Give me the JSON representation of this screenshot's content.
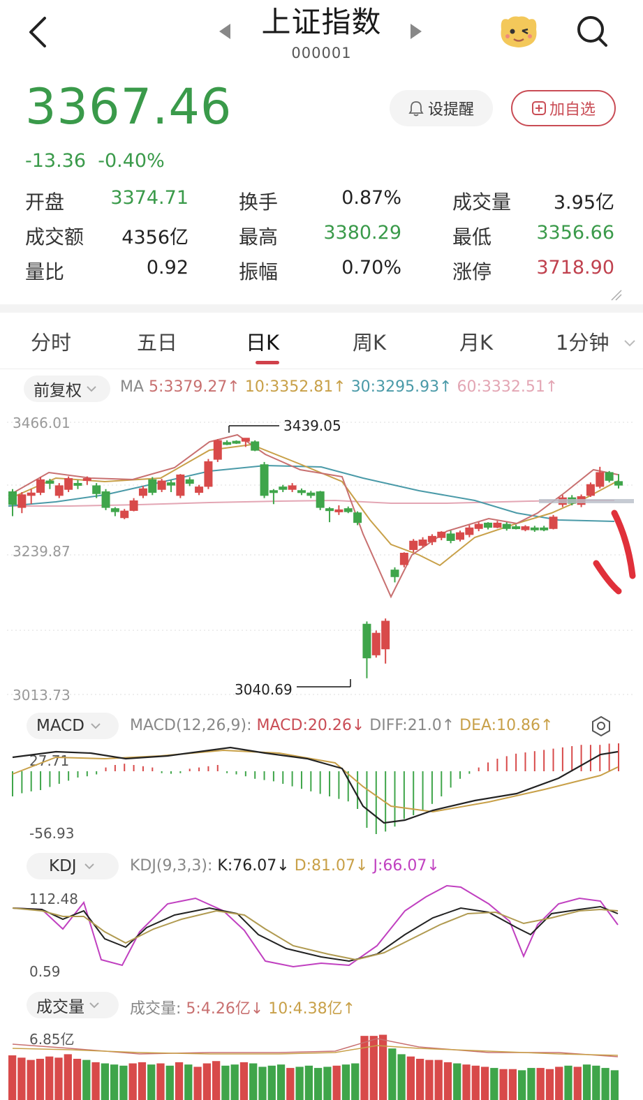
{
  "header": {
    "title": "上证指数",
    "code": "000001"
  },
  "quote": {
    "price": "3367.46",
    "change": "-13.36",
    "change_pct": "-0.40%",
    "alert_label": "设提醒",
    "add_label": "加自选"
  },
  "stats": [
    [
      {
        "label": "开盘",
        "value": "3374.71",
        "color": "green"
      },
      {
        "label": "换手",
        "value": "0.87%",
        "color": "dark"
      },
      {
        "label": "成交量",
        "value": "3.95亿",
        "color": "dark"
      }
    ],
    [
      {
        "label": "成交额",
        "value": "4356亿",
        "color": "dark"
      },
      {
        "label": "最高",
        "value": "3380.29",
        "color": "green"
      },
      {
        "label": "最低",
        "value": "3356.66",
        "color": "green"
      }
    ],
    [
      {
        "label": "量比",
        "value": "0.92",
        "color": "dark"
      },
      {
        "label": "振幅",
        "value": "0.70%",
        "color": "dark"
      },
      {
        "label": "涨停",
        "value": "3718.90",
        "color": "red"
      }
    ]
  ],
  "tabs": [
    "分时",
    "五日",
    "日K",
    "周K",
    "月K",
    "1分钟"
  ],
  "active_tab": 2,
  "ma_bar": {
    "adjust_label": "前复权",
    "ma_prefix": "MA",
    "ma5": "5:3379.27",
    "ma10": "10:3352.81",
    "ma30": "30:3295.93",
    "ma60": "60:3332.51",
    "arrow": "↑"
  },
  "macd_bar": {
    "label": "MACD",
    "params": "MACD(12,26,9):",
    "macd": "MACD:20.26",
    "macd_arrow": "↓",
    "diff": "DIFF:21.0",
    "diff_arrow": "↑",
    "dea": "DEA:10.86",
    "dea_arrow": "↑"
  },
  "kdj_bar": {
    "label": "KDJ",
    "params": "KDJ(9,3,3):",
    "k": "K:76.07",
    "d": "D:81.07",
    "j": "J:66.07",
    "arrow": "↓"
  },
  "vol_bar": {
    "label": "成交量",
    "params": "成交量:",
    "v5": "5:4.26亿",
    "v5_arrow": "↓",
    "v10": "10:4.38亿",
    "v10_arrow": "↑"
  },
  "chart_data": [
    {
      "type": "candlestick",
      "yaxis_labels": [
        "3466.01",
        "3239.87",
        "3013.73"
      ],
      "ylim": [
        3013.73,
        3466.01
      ],
      "annotations": [
        {
          "label": "3439.05"
        },
        {
          "label": "3040.69"
        }
      ],
      "candles": [
        [
          3330,
          3350,
          3310,
          3355,
          "g"
        ],
        [
          3325,
          3345,
          3315,
          3350,
          "r"
        ],
        [
          3345,
          3348,
          3330,
          3355,
          "r"
        ],
        [
          3350,
          3370,
          3345,
          3375,
          "r"
        ],
        [
          3365,
          3368,
          3355,
          3372,
          "g"
        ],
        [
          3345,
          3360,
          3340,
          3365,
          "r"
        ],
        [
          3355,
          3372,
          3350,
          3376,
          "r"
        ],
        [
          3362,
          3364,
          3355,
          3370,
          "g"
        ],
        [
          3370,
          3372,
          3362,
          3376,
          "r"
        ],
        [
          3360,
          3348,
          3340,
          3365,
          "g"
        ],
        [
          3350,
          3325,
          3320,
          3355,
          "g"
        ],
        [
          3322,
          3318,
          3310,
          3325,
          "g"
        ],
        [
          3308,
          3318,
          3305,
          3322,
          "r"
        ],
        [
          3320,
          3335,
          3318,
          3340,
          "r"
        ],
        [
          3345,
          3355,
          3340,
          3360,
          "r"
        ],
        [
          3370,
          3350,
          3345,
          3375,
          "g"
        ],
        [
          3355,
          3368,
          3350,
          3372,
          "r"
        ],
        [
          3365,
          3362,
          3350,
          3370,
          "g"
        ],
        [
          3345,
          3378,
          3340,
          3380,
          "r"
        ],
        [
          3365,
          3370,
          3360,
          3375,
          "g"
        ],
        [
          3350,
          3358,
          3345,
          3362,
          "r"
        ],
        [
          3360,
          3400,
          3355,
          3405,
          "r"
        ],
        [
          3405,
          3435,
          3400,
          3438,
          "r"
        ],
        [
          3430,
          3432,
          3428,
          3436,
          "g"
        ],
        [
          3432,
          3434,
          3430,
          3436,
          "g"
        ],
        [
          3435,
          3439.05,
          3425,
          3439,
          "r"
        ],
        [
          3433,
          3420,
          3418,
          3436,
          "g"
        ],
        [
          3395,
          3345,
          3340,
          3400,
          "g"
        ],
        [
          3350,
          3352,
          3330,
          3355,
          "g"
        ],
        [
          3355,
          3358,
          3350,
          3362,
          "g"
        ],
        [
          3355,
          3360,
          3350,
          3365,
          "r"
        ],
        [
          3350,
          3352,
          3345,
          3356,
          "g"
        ],
        [
          3348,
          3345,
          3340,
          3352,
          "g"
        ],
        [
          3350,
          3325,
          3320,
          3352,
          "g"
        ],
        [
          3320,
          3322,
          3300,
          3325,
          "g"
        ],
        [
          3318,
          3320,
          3312,
          3328,
          "r"
        ],
        [
          3322,
          3318,
          3315,
          3326,
          "g"
        ],
        [
          3315,
          3300,
          3295,
          3318,
          "g"
        ],
        [
          3130,
          3075,
          3040.69,
          3135,
          "g"
        ],
        [
          3080,
          3115,
          3075,
          3120,
          "r"
        ],
        [
          3135,
          3090,
          3065,
          3140,
          "r"
        ],
        [
          3210,
          3220,
          3200,
          3225,
          "g"
        ],
        [
          3230,
          3248,
          3225,
          3250,
          "r"
        ],
        [
          3255,
          3268,
          3250,
          3272,
          "r"
        ],
        [
          3262,
          3270,
          3258,
          3275,
          "r"
        ],
        [
          3268,
          3276,
          3262,
          3280,
          "r"
        ],
        [
          3275,
          3283,
          3270,
          3285,
          "r"
        ],
        [
          3280,
          3270,
          3265,
          3286,
          "g"
        ],
        [
          3272,
          3282,
          3268,
          3286,
          "r"
        ],
        [
          3280,
          3290,
          3275,
          3295,
          "r"
        ],
        [
          3290,
          3296,
          3285,
          3300,
          "r"
        ],
        [
          3298,
          3292,
          3288,
          3300,
          "g"
        ],
        [
          3292,
          3298,
          3290,
          3302,
          "r"
        ],
        [
          3296,
          3290,
          3286,
          3300,
          "g"
        ],
        [
          3292,
          3290,
          3288,
          3296,
          "g"
        ],
        [
          3288,
          3292,
          3285,
          3295,
          "r"
        ],
        [
          3290,
          3288,
          3284,
          3294,
          "g"
        ],
        [
          3288,
          3290,
          3285,
          3294,
          "g"
        ],
        [
          3290,
          3308,
          3288,
          3312,
          "r"
        ],
        [
          3330,
          3340,
          3325,
          3345,
          "r"
        ],
        [
          3340,
          3332,
          3328,
          3345,
          "g"
        ],
        [
          3330,
          3342,
          3325,
          3346,
          "r"
        ],
        [
          3345,
          3362,
          3342,
          3366,
          "r"
        ],
        [
          3360,
          3382,
          3356,
          3392,
          "r"
        ],
        [
          3382,
          3370,
          3366,
          3385,
          "g"
        ],
        [
          3367,
          3362,
          3356,
          3380,
          "g"
        ]
      ]
    },
    {
      "type": "bar+line",
      "name": "MACD",
      "yaxis_labels": [
        "27.71",
        "-56.93"
      ],
      "ylim": [
        -56.93,
        27.71
      ]
    },
    {
      "type": "line",
      "name": "KDJ",
      "yaxis_labels": [
        "112.48",
        "0.59"
      ],
      "ylim": [
        0.59,
        112.48
      ]
    },
    {
      "type": "bar",
      "name": "成交量",
      "yaxis_labels": [
        "6.85亿"
      ]
    }
  ],
  "colors": {
    "up": "#d84a4a",
    "down": "#3fa54a",
    "ma5": "#c87070",
    "ma10": "#c8a048",
    "ma30": "#4a9aa8",
    "ma60": "#e3a6b4"
  }
}
